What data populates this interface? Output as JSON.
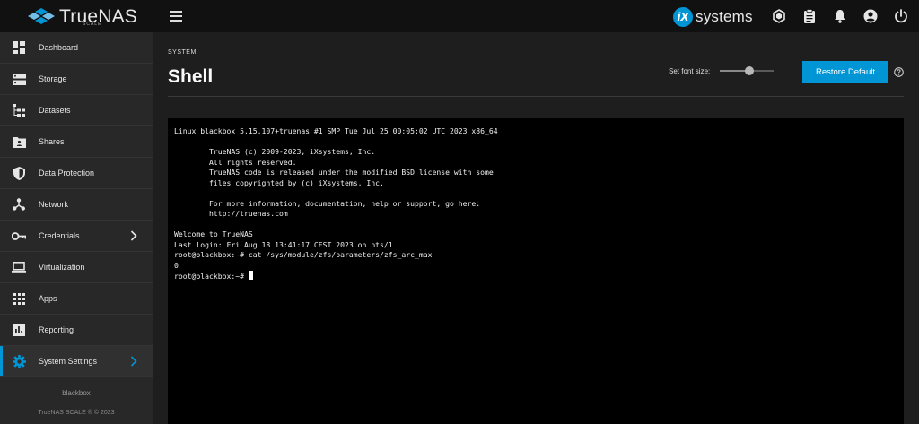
{
  "brand": {
    "name": "TrueNAS",
    "sub": "SCALE"
  },
  "vendor": {
    "badge": "iX",
    "name": "systems"
  },
  "topbar_icons": [
    "truecommand-icon",
    "jobs-clipboard-icon",
    "bell-icon",
    "account-circle-icon",
    "power-icon"
  ],
  "sidebar": {
    "items": [
      {
        "label": "Dashboard",
        "icon": "dashboard-icon",
        "chevron": false,
        "active": false
      },
      {
        "label": "Storage",
        "icon": "storage-icon",
        "chevron": false,
        "active": false
      },
      {
        "label": "Datasets",
        "icon": "datasets-icon",
        "chevron": false,
        "active": false
      },
      {
        "label": "Shares",
        "icon": "shares-folder-icon",
        "chevron": false,
        "active": false
      },
      {
        "label": "Data Protection",
        "icon": "shield-icon",
        "chevron": false,
        "active": false
      },
      {
        "label": "Network",
        "icon": "network-icon",
        "chevron": false,
        "active": false
      },
      {
        "label": "Credentials",
        "icon": "key-icon",
        "chevron": true,
        "active": false
      },
      {
        "label": "Virtualization",
        "icon": "laptop-icon",
        "chevron": false,
        "active": false
      },
      {
        "label": "Apps",
        "icon": "apps-grid-icon",
        "chevron": false,
        "active": false
      },
      {
        "label": "Reporting",
        "icon": "reporting-chart-icon",
        "chevron": false,
        "active": false
      },
      {
        "label": "System Settings",
        "icon": "gear-icon",
        "chevron": true,
        "active": true
      }
    ],
    "hostname": "blackbox",
    "copyright": "TrueNAS SCALE ® © 2023"
  },
  "page": {
    "breadcrumb": "SYSTEM",
    "title": "Shell",
    "font_size_label": "Set font size:",
    "font_size_slider_fraction": 0.55,
    "restore_label": "Restore Default"
  },
  "colors": {
    "accent": "#0095d5",
    "topbar": "#111111",
    "sidebar": "#282828",
    "main": "#1e1e1e",
    "terminal": "#000000"
  },
  "terminal": {
    "lines": [
      "Linux blackbox 5.15.107+truenas #1 SMP Tue Jul 25 00:05:02 UTC 2023 x86_64",
      "",
      "        TrueNAS (c) 2009-2023, iXsystems, Inc.",
      "        All rights reserved.",
      "        TrueNAS code is released under the modified BSD license with some",
      "        files copyrighted by (c) iXsystems, Inc.",
      "",
      "        For more information, documentation, help or support, go here:",
      "        http://truenas.com",
      "",
      "Welcome to TrueNAS",
      "Last login: Fri Aug 18 13:41:17 CEST 2023 on pts/1",
      "root@blackbox:~# cat /sys/module/zfs/parameters/zfs_arc_max",
      "0"
    ],
    "prompt": "root@blackbox:~# "
  }
}
